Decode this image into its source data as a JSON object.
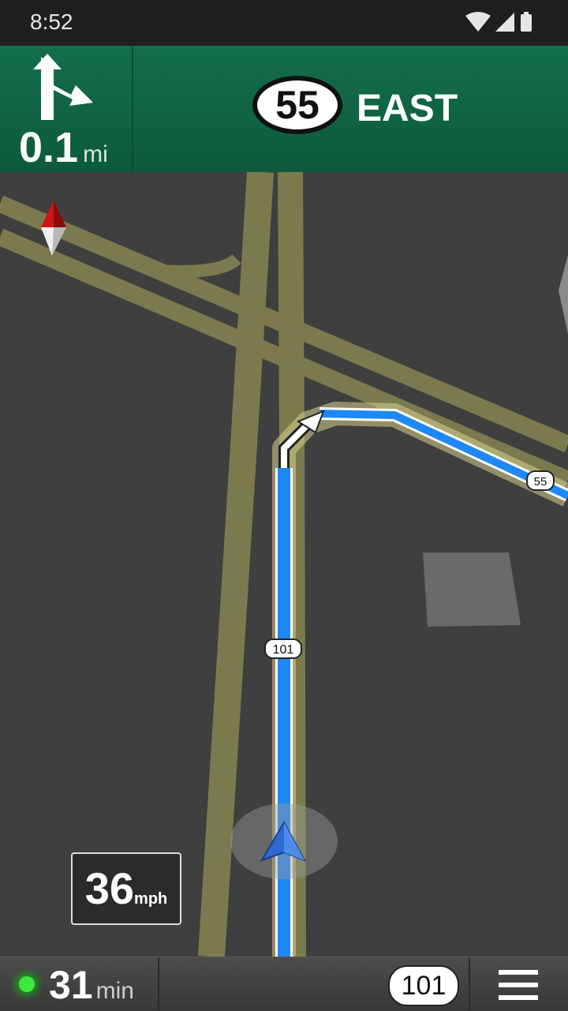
{
  "status_bar": {
    "time": "8:52",
    "icons": [
      "wifi-icon",
      "cell-signal-icon",
      "battery-icon"
    ]
  },
  "nav_banner": {
    "maneuver_icon": "turn-right-arrow-icon",
    "distance_value": "0.1",
    "distance_unit": "mi",
    "route_number": "55",
    "direction": "EAST"
  },
  "map": {
    "current_road_label": "101",
    "next_road_label": "55",
    "compass_icon": "compass-icon",
    "vehicle_icon": "navigation-arrow-icon"
  },
  "speed": {
    "value": "36",
    "unit": "mph"
  },
  "bottom_bar": {
    "eta_value": "31",
    "eta_unit": "min",
    "route_shield": "101",
    "menu_icon": "hamburger-menu-icon"
  },
  "colors": {
    "banner_green": "#0f6244",
    "route_blue": "#1e88f5",
    "road_olive": "#7a7a4e",
    "map_bg": "#3f3f3f"
  }
}
